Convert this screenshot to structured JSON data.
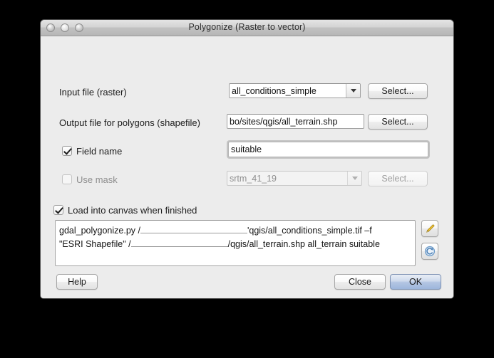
{
  "window": {
    "title": "Polygonize (Raster to vector)",
    "traffic_lights": [
      "close",
      "minimize",
      "zoom"
    ]
  },
  "form": {
    "input_file": {
      "label": "Input file (raster)",
      "value": "all_conditions_simple",
      "select_label": "Select...",
      "enabled": true
    },
    "output_file": {
      "label": "Output file for polygons (shapefile)",
      "value": "bo/sites/qgis/all_terrain.shp",
      "select_label": "Select...",
      "enabled": true
    },
    "field_name": {
      "label": "Field name",
      "checked": true,
      "value": "suitable",
      "enabled": true
    },
    "use_mask": {
      "label": "Use mask",
      "checked": false,
      "value": "srtm_41_19",
      "select_label": "Select...",
      "enabled": false
    },
    "load_into_canvas": {
      "label": "Load into canvas when finished",
      "checked": true
    }
  },
  "command": {
    "line1_pre": "gdal_polygonize.py /",
    "line1_post": "'qgis/all_conditions_simple.tif –f",
    "line2_pre": "\"ESRI Shapefile\" /",
    "line2_post": "/qgis/all_terrain.shp all_terrain suitable"
  },
  "side_buttons": {
    "edit": "pencil-icon",
    "reset": "refresh-icon"
  },
  "footer": {
    "help": "Help",
    "close": "Close",
    "ok": "OK"
  },
  "colors": {
    "window_bg": "#ececec",
    "default_button": "#b4c6e3",
    "pencil_yellow": "#f2c230",
    "refresh_blue": "#7aa8d8"
  }
}
